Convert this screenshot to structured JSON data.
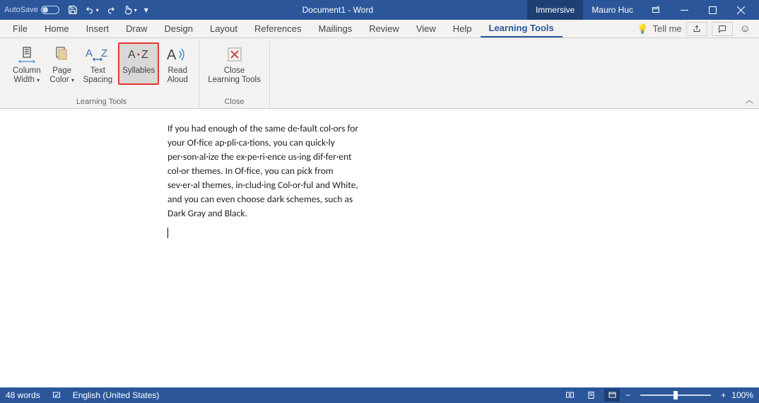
{
  "titlebar": {
    "autosave": "AutoSave",
    "title": "Document1 - Word",
    "mode": "Immersive",
    "user": "Mauro Huc"
  },
  "tabs": {
    "file": "File",
    "home": "Home",
    "insert": "Insert",
    "draw": "Draw",
    "design": "Design",
    "layout": "Layout",
    "references": "References",
    "mailings": "Mailings",
    "review": "Review",
    "view": "View",
    "help": "Help",
    "learning_tools": "Learning Tools",
    "tellme": "Tell me"
  },
  "ribbon": {
    "column_width": "Column\nWidth",
    "page_color": "Page\nColor",
    "text_spacing": "Text\nSpacing",
    "syllables": "Syllables",
    "read_aloud": "Read\nAloud",
    "close_lt": "Close\nLearning Tools",
    "group_lt": "Learning Tools",
    "group_close": "Close"
  },
  "document": {
    "text": "If you had enough of the same de·fault col·ors for your Of·fice ap·pli·ca·tions, you can quick·ly per·son·al·ize the ex·pe·ri·ence us·ing dif·fer·ent col·or themes. In Of·fice, you can pick from sev·er·al themes, in·clud·ing Col·or·ful and White, and you can even choose dark schemes, such as Dark Gray and Black."
  },
  "statusbar": {
    "words": "48 words",
    "language": "English (United States)",
    "zoom": "100%"
  }
}
